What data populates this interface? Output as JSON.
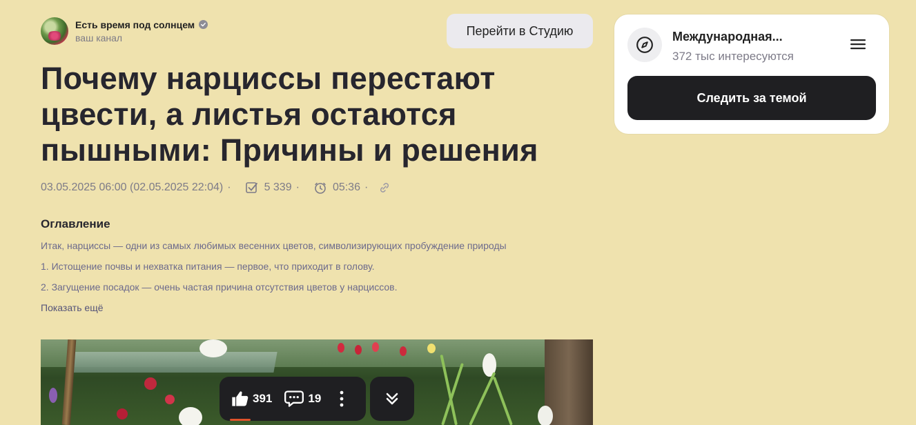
{
  "channel": {
    "name": "Есть время под солнцем",
    "subtitle": "ваш канал"
  },
  "header": {
    "studio_button": "Перейти в Студию"
  },
  "article": {
    "title": "Почему нарциссы перестают цвести, а листья остаются пышными: Причины и решения",
    "date": "03.05.2025 06:00 (02.05.2025 22:04)",
    "reads": "5 339",
    "read_time": "05:36",
    "separator": "·"
  },
  "toc": {
    "heading": "Оглавление",
    "items": [
      "Итак, нарциссы — одни из самых любимых весенних цветов, символизирующих пробуждение природы",
      "1. Истощение почвы и нехватка питания — первое, что приходит в голову.",
      "2. Загущение посадок — очень частая причина отсутствия цветов у нарциссов."
    ],
    "show_more": "Показать ещё"
  },
  "actions": {
    "likes": "391",
    "comments": "19"
  },
  "topic": {
    "name": "Международная...",
    "followers": "372 тыс интересуются",
    "follow_button": "Следить за темой"
  },
  "icons": {
    "verified": "verified-check-icon",
    "reads": "checkbox-icon",
    "time": "clock-icon",
    "link": "link-icon",
    "like": "thumbs-up-icon",
    "comment": "comment-bubble-icon",
    "more": "vertical-dots-icon",
    "scroll": "double-chevron-down-icon",
    "topic": "compass-icon",
    "menu": "hamburger-menu-icon"
  },
  "colors": {
    "background": "#efe2ae",
    "dark_button": "#1f1f22",
    "muted_text": "#7d7b88",
    "toc_link": "#6c6a8c"
  }
}
